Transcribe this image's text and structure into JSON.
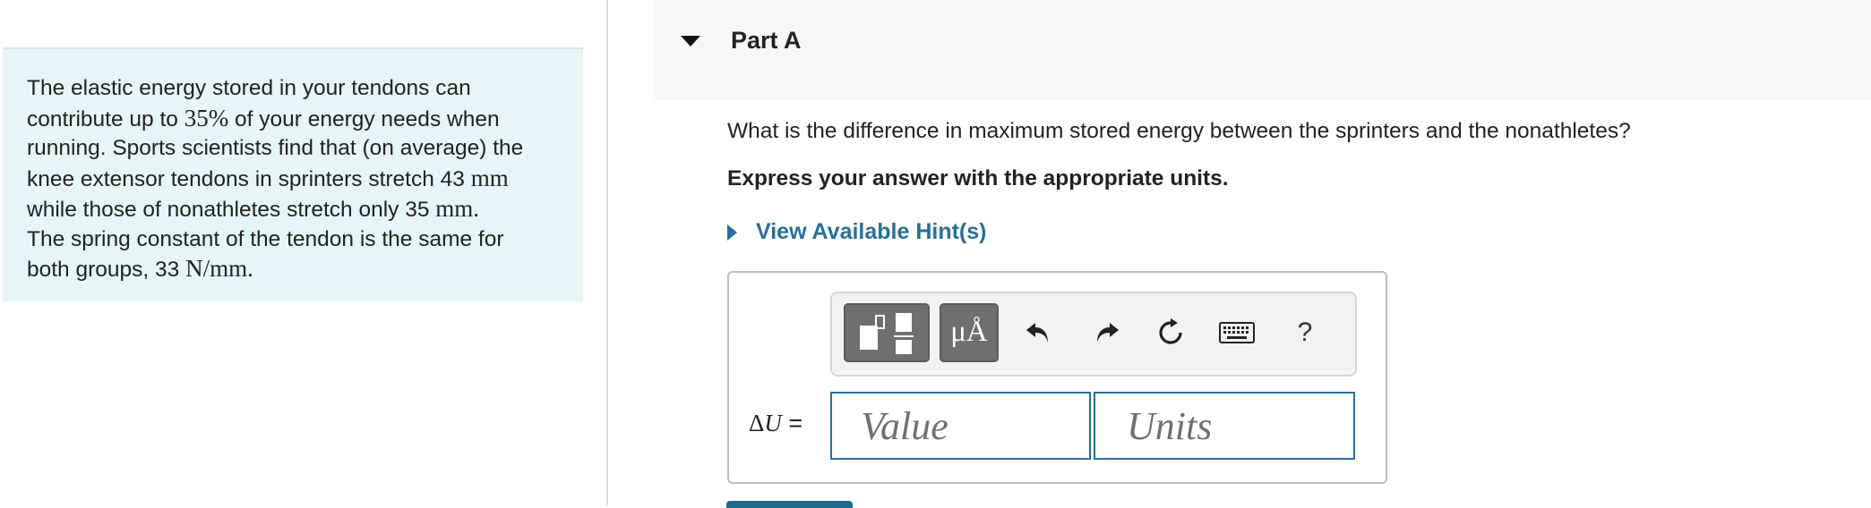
{
  "problem": {
    "lines": [
      [
        "The elastic energy stored in your tendons can"
      ],
      [
        "contribute up to ",
        "35%",
        " of your energy needs when"
      ],
      [
        "running. Sports scientists find that (on average) the"
      ],
      [
        "knee extensor tendons in sprinters stretch 43 ",
        "mm"
      ],
      [
        "while those of nonathletes stretch only 35 ",
        "mm."
      ],
      [
        "The spring constant of the tendon is the same for"
      ],
      [
        "both groups, 33 ",
        "N/mm."
      ]
    ]
  },
  "part": {
    "title": "Part A",
    "caret_icon": "caret-down-icon"
  },
  "question": {
    "text": "What is the difference in maximum stored energy between the sprinters and the nonathletes?",
    "instruction": "Express your answer with the appropriate units."
  },
  "hint": {
    "label": "View Available Hint(s)",
    "link_color": "#2a6f97"
  },
  "toolbar": {
    "units_label": "μÅ",
    "help_label": "?",
    "icons": [
      "fraction-template-icon",
      "units-template-icon",
      "undo-icon",
      "redo-icon",
      "reset-icon",
      "keyboard-icon",
      "help-icon"
    ]
  },
  "answer": {
    "variable_prefix": "Δ",
    "variable": "U",
    "equals": " =",
    "value_placeholder": "Value",
    "units_placeholder": "Units",
    "value": "",
    "units": ""
  },
  "colors": {
    "problem_bg": "#e8f5f5",
    "header_bg": "#f7f7f7",
    "accent": "#2a6f97",
    "toolbar_button": "#6f6f6f"
  }
}
